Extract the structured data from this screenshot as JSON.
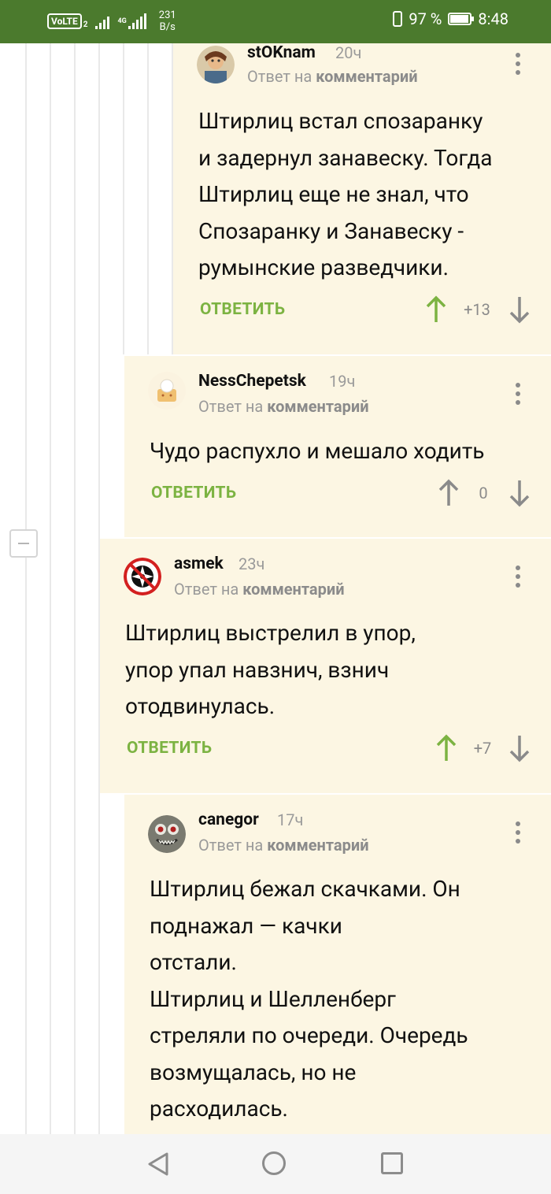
{
  "status_bar": {
    "volte": "VoLTE",
    "volte_sim": "2",
    "network": "4G",
    "speed_value": "231",
    "speed_unit": "B/s",
    "battery_text": "97 %",
    "battery_level": 0.97,
    "time": "8:48"
  },
  "colors": {
    "status_bar": "#4b7a2d",
    "comment_bg": "#fcf6e3",
    "accent_green": "#7cb342"
  },
  "comments": [
    {
      "author": "stOKnam",
      "time": "20ч",
      "reply_prefix": "Ответ на",
      "reply_target": "комментарий",
      "text": "Штирлиц встал спозаранку\nи задернул занавеску. Тогда\nШтирлиц еще не знал, что\nСпозаранку и Занавеску -\nрумынские разведчики.",
      "reply_label": "ОТВЕТИТЬ",
      "rating": "+13",
      "upvoted": true
    },
    {
      "author": "NessChepetsk",
      "time": "19ч",
      "reply_prefix": "Ответ на",
      "reply_target": "комментарий",
      "text": "Чудо распухло и мешало ходить",
      "reply_label": "ОТВЕТИТЬ",
      "rating": "0",
      "upvoted": false
    },
    {
      "author": "asmek",
      "time": "23ч",
      "reply_prefix": "Ответ на",
      "reply_target": "комментарий",
      "text": "Штирлиц выстрелил в упор,\nупор упал навзнич, взнич\nотодвинулась.",
      "reply_label": "ОТВЕТИТЬ",
      "rating": "+7",
      "upvoted": true
    },
    {
      "author": "canegor",
      "time": "17ч",
      "reply_prefix": "Ответ на",
      "reply_target": "комментарий",
      "text": "Штирлиц бежал скачками. Он\nподнажал — качки\nотстали.\nШтирлиц и Шелленберг\nстреляли по очереди. Очередь\nвозмущалась, но не\nрасходилась."
    }
  ],
  "icons": {
    "collapse": "minus-icon",
    "upvote": "arrow-up-icon",
    "downvote": "arrow-down-icon",
    "more": "more-vertical-icon",
    "nav_back": "nav-back-icon",
    "nav_home": "nav-home-icon",
    "nav_recent": "nav-recent-icon"
  }
}
